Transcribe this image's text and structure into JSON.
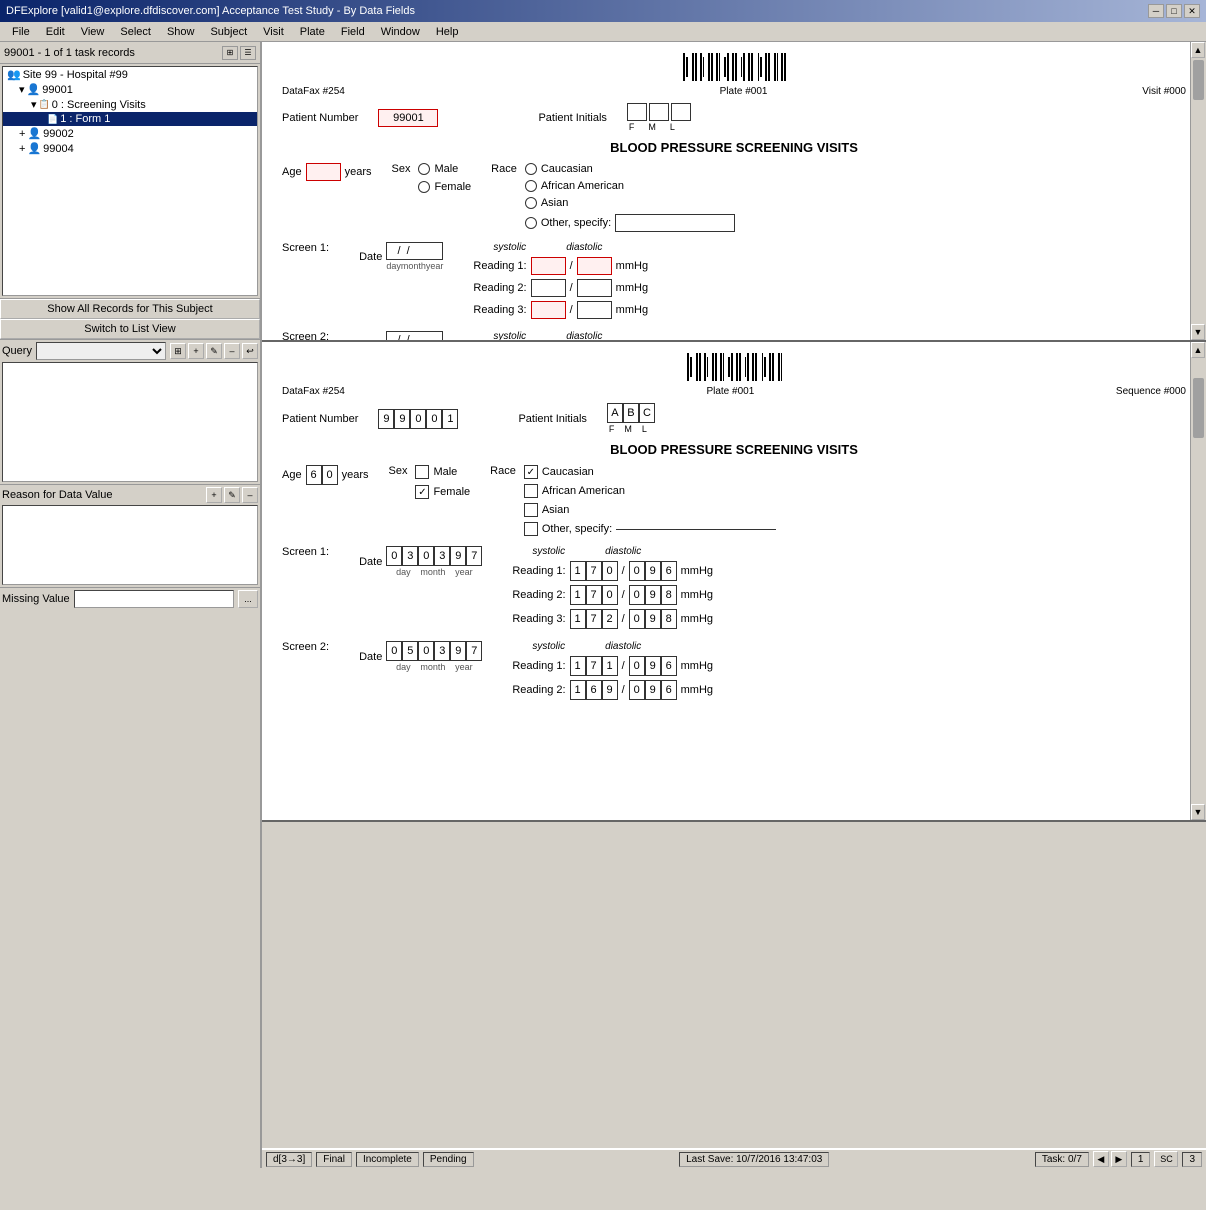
{
  "window": {
    "title": "DFExplore [valid1@explore.dfdiscover.com] Acceptance Test Study - By Data Fields",
    "title_icon": "df-icon"
  },
  "menu": {
    "items": [
      "File",
      "Edit",
      "View",
      "Select",
      "Show",
      "Subject",
      "Visit",
      "Plate",
      "Field",
      "Window",
      "Help"
    ]
  },
  "task_bar": {
    "label": "99001 - 1 of 1 task records",
    "icon1": "grid-icon",
    "icon2": "list-icon"
  },
  "tree": {
    "nodes": [
      {
        "id": "site99",
        "label": "Site 99 - Hospital #99",
        "level": 1,
        "icon": "site-icon",
        "selected": false,
        "expanded": true
      },
      {
        "id": "99001",
        "label": "99001",
        "level": 2,
        "icon": "patient-icon",
        "selected": false,
        "expanded": true
      },
      {
        "id": "visit0",
        "label": "0 : Screening Visits",
        "level": 3,
        "icon": "visit-icon",
        "selected": false,
        "expanded": true
      },
      {
        "id": "form1",
        "label": "1 : Form 1",
        "level": 4,
        "icon": "form-icon",
        "selected": true,
        "expanded": false
      },
      {
        "id": "99002",
        "label": "99002",
        "level": 2,
        "icon": "patient-icon",
        "selected": false
      },
      {
        "id": "99004",
        "label": "99004",
        "level": 2,
        "icon": "patient-icon",
        "selected": false
      }
    ]
  },
  "buttons": {
    "show_all": "Show All Records for This Subject",
    "switch_list": "Switch to List View"
  },
  "query": {
    "label": "Query",
    "placeholder": "",
    "buttons": [
      "grid-btn",
      "add-btn",
      "edit-btn",
      "delete-btn",
      "undo-btn"
    ]
  },
  "reason": {
    "label": "Reason for Data Value",
    "buttons": [
      "add-btn",
      "edit-btn",
      "delete-btn"
    ]
  },
  "missing": {
    "label": "Missing Value",
    "btn": "..."
  },
  "upper_form": {
    "datafax": "DataFax #254",
    "plate": "Plate #001",
    "visit": "Visit #000",
    "patient_number_label": "Patient Number",
    "patient_number_value": "99001",
    "patient_initials_label": "Patient Initials",
    "initials_labels": [
      "F",
      "M",
      "L"
    ],
    "title": "BLOOD PRESSURE SCREENING VISITS",
    "age_label": "Age",
    "age_unit": "years",
    "sex_label": "Sex",
    "sex_options": [
      "Male",
      "Female"
    ],
    "race_label": "Race",
    "race_options": [
      "Caucasian",
      "African American",
      "Asian",
      "Other, specify:"
    ],
    "screen1_label": "Screen 1:",
    "date_label": "Date",
    "date_sublabels": [
      "day",
      "month",
      "year"
    ],
    "systolic_label": "systolic",
    "diastolic_label": "diastolic",
    "reading1": "Reading 1:",
    "reading2": "Reading 2:",
    "reading3": "Reading 3:",
    "mmhg": "mmHg",
    "screen2_label": "Screen 2:"
  },
  "lower_form": {
    "datafax": "DataFax #254",
    "plate": "Plate #001",
    "sequence": "Sequence #000",
    "patient_number_label": "Patient Number",
    "patient_number_chars": [
      "9",
      "9",
      "0",
      "0",
      "1"
    ],
    "patient_initials_label": "Patient Initials",
    "initials_chars": [
      "A",
      "B",
      "C"
    ],
    "initials_labels": [
      "F",
      "M",
      "L"
    ],
    "title": "BLOOD PRESSURE SCREENING VISITS",
    "age_label": "Age",
    "age_chars": [
      "6",
      "0"
    ],
    "age_unit": "years",
    "sex_label": "Sex",
    "sex_male_label": "Male",
    "sex_female_label": "Female",
    "sex_male_checked": false,
    "sex_female_checked": true,
    "race_label": "Race",
    "race_caucasian": "Caucasian",
    "race_caucasian_checked": true,
    "race_african": "African American",
    "race_african_checked": false,
    "race_asian": "Asian",
    "race_asian_checked": false,
    "race_other": "Other, specify:",
    "race_other_checked": false,
    "screen1_label": "Screen 1:",
    "date_label": "Date",
    "screen1_date_chars": [
      "0",
      "3",
      "0",
      "3",
      "9",
      "7"
    ],
    "date_sublabels": [
      "day",
      "month",
      "year"
    ],
    "systolic_label": "systolic",
    "diastolic_label": "diastolic",
    "screen1_r1_sys": [
      "1",
      "7",
      "0"
    ],
    "screen1_r1_dia": [
      "0",
      "9",
      "6"
    ],
    "screen1_r2_sys": [
      "1",
      "7",
      "0"
    ],
    "screen1_r2_dia": [
      "0",
      "9",
      "8"
    ],
    "screen1_r3_sys": [
      "1",
      "7",
      "2"
    ],
    "screen1_r3_dia": [
      "0",
      "9",
      "8"
    ],
    "reading1": "Reading 1:",
    "reading2": "Reading 2:",
    "reading3": "Reading 3:",
    "mmhg": "mmHg",
    "screen2_label": "Screen 2:",
    "screen2_date_chars": [
      "0",
      "5",
      "0",
      "3",
      "9",
      "7"
    ],
    "screen2_sublabels": [
      "day",
      "month",
      "year"
    ],
    "screen2_r1_sys": [
      "1",
      "7",
      "1"
    ],
    "screen2_r1_dia": [
      "0",
      "9",
      "6"
    ],
    "screen2_r2_sys": [
      "1",
      "6",
      "9"
    ],
    "screen2_r2_dia": [
      "0",
      "9",
      "6"
    ]
  },
  "status_bar": {
    "transition": "d[3→3]",
    "status1": "Final",
    "status2": "Incomplete",
    "status3": "Pending",
    "task_label": "Task: 0/7",
    "num1": "1",
    "sc_btn": "SC",
    "num3": "3",
    "save": "Last Save: 10/7/2016 13:47:03"
  }
}
